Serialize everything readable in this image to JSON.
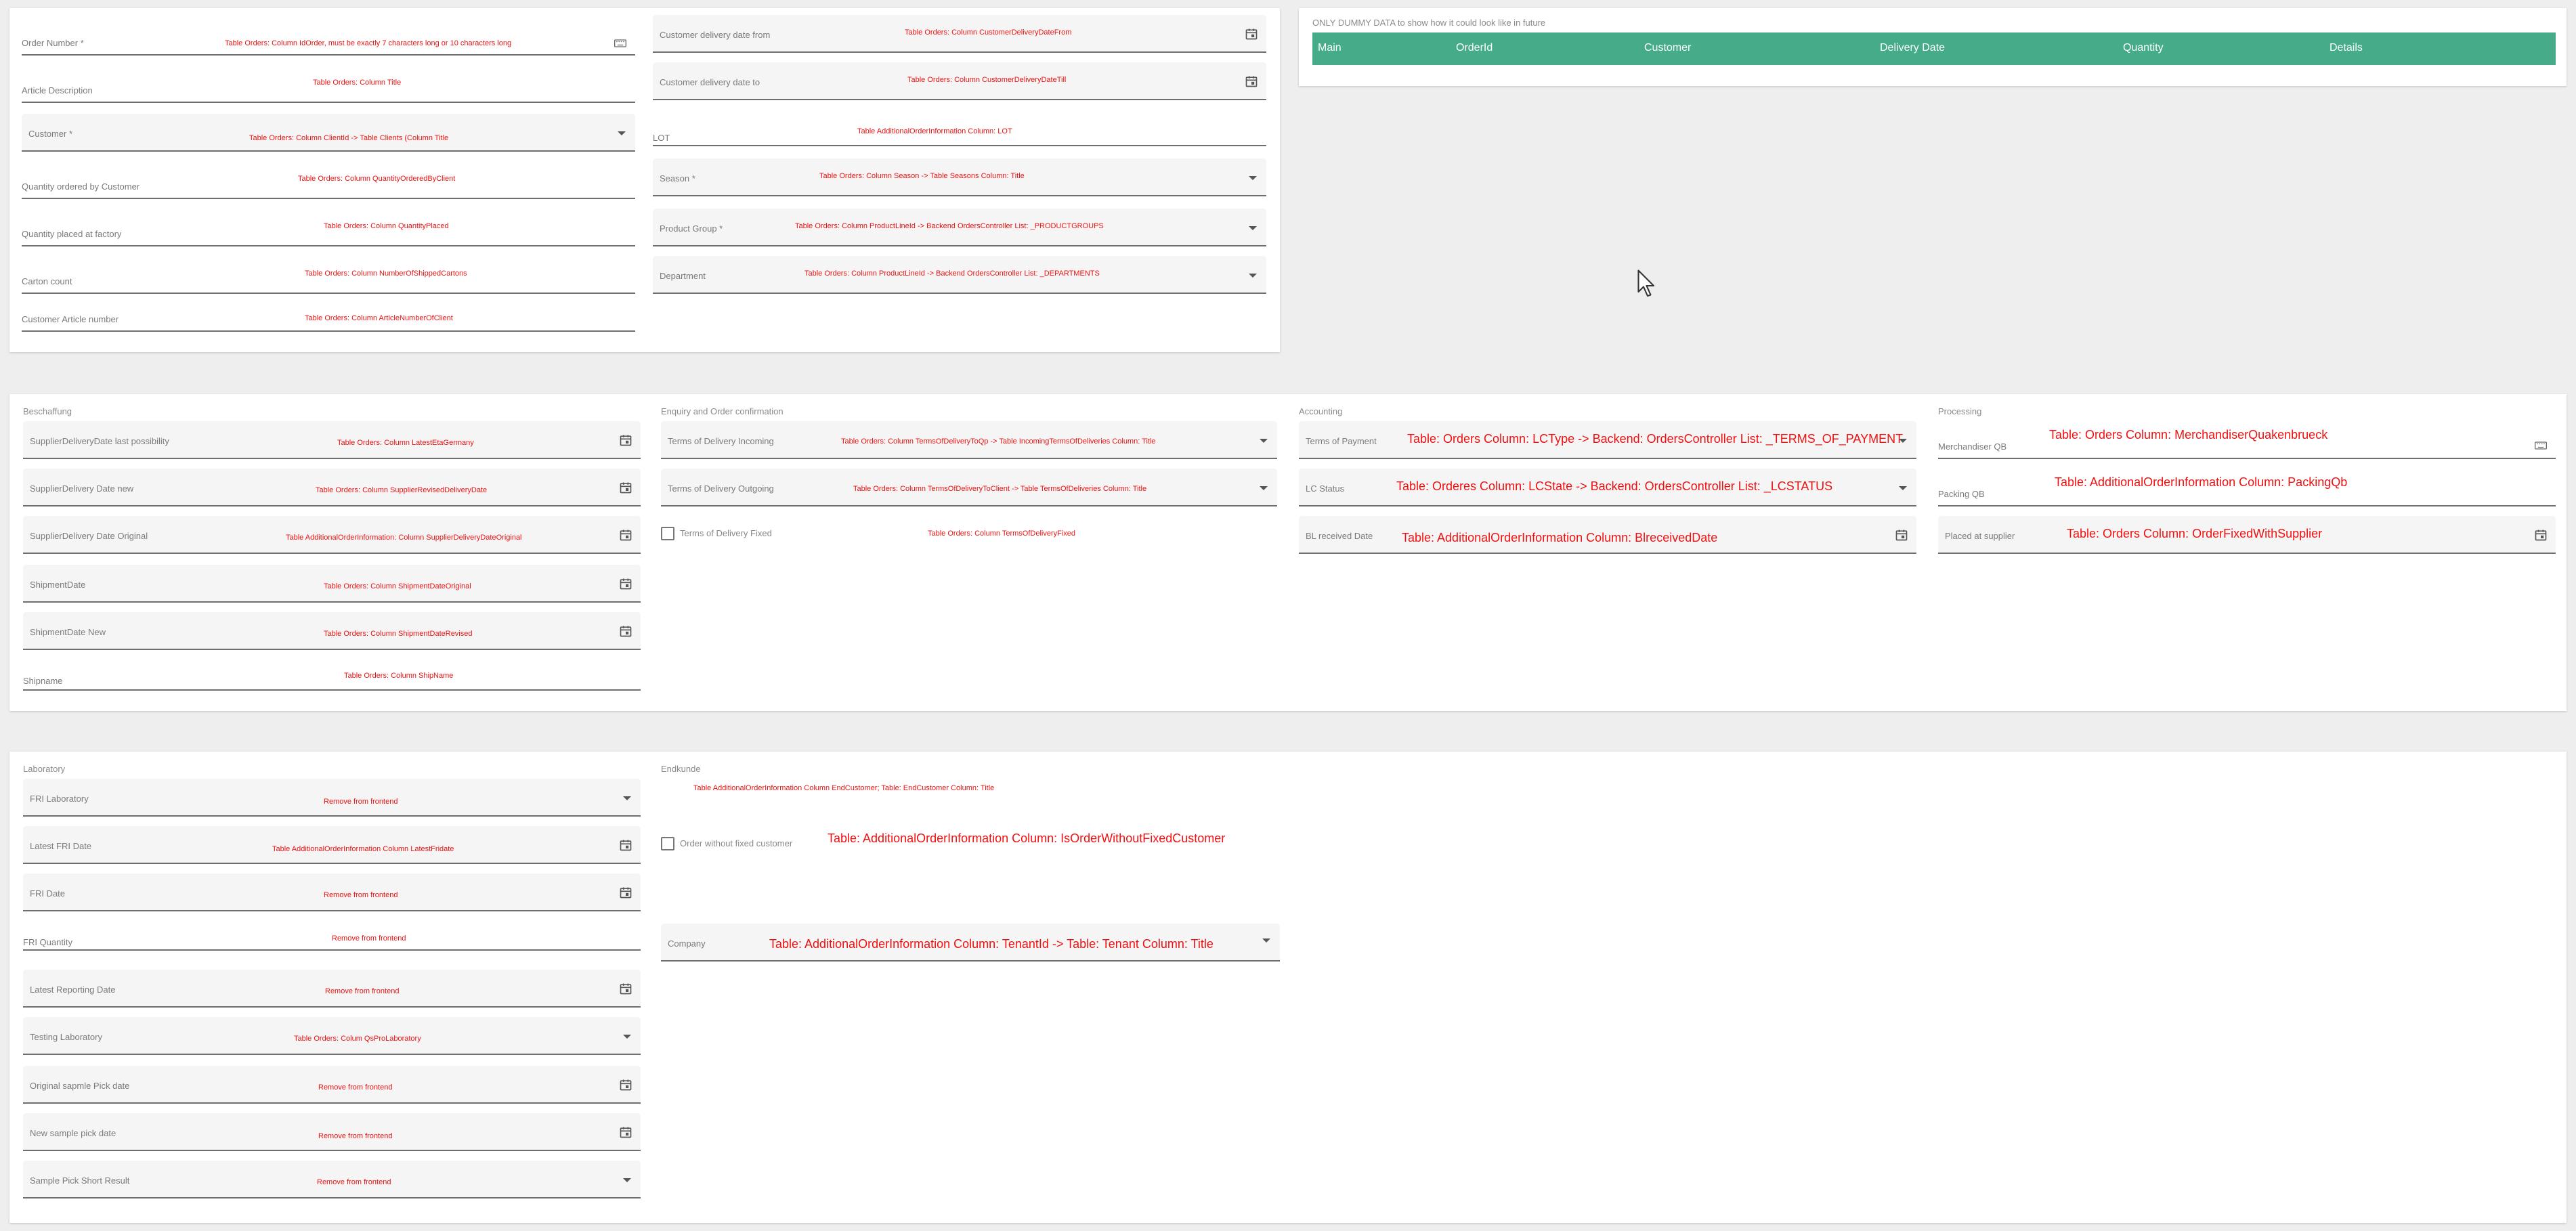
{
  "orderForm": {
    "left": [
      {
        "label": "Order Number *",
        "note": "Table Orders: Column IdOrder, must be exactly 7 characters long or 10 characters long",
        "icon": "calendar-icon"
      },
      {
        "label": "Article Description",
        "note": "Table Orders: Column Title"
      },
      {
        "label": "Customer *",
        "note": "Table Orders: Column ClientId -> Table Clients (Column Title",
        "icon": "dropdown-caret-icon"
      },
      {
        "label": "Quantity ordered by Customer",
        "note": "Table Orders: Column QuantityOrderedByClient"
      },
      {
        "label": "Quantity placed at factory",
        "note": "Table Orders: Column QuantityPlaced"
      },
      {
        "label": "Carton count",
        "note": "Table Orders: Column NumberOfShippedCartons"
      },
      {
        "label": "Customer Article number",
        "note": "Table Orders: Column ArticleNumberOfClient"
      }
    ],
    "right": [
      {
        "label": "Customer delivery date from",
        "note": "Table Orders: Column CustomerDeliveryDateFrom",
        "icon": "calendar-icon"
      },
      {
        "label": "Customer delivery date to",
        "note": "Table Orders: Column CustomerDeliveryDateTill",
        "icon": "calendar-icon"
      },
      {
        "label": "LOT",
        "note": "Table AdditionalOrderInformation Column: LOT"
      },
      {
        "label": "Season *",
        "note": "Table Orders: Column Season -> Table Seasons Column: Title",
        "icon": "dropdown-caret-icon"
      },
      {
        "label": "Product Group *",
        "note": "Table Orders: Column ProductLineId -> Backend OrdersController List: _PRODUCTGROUPS",
        "icon": "dropdown-caret-icon"
      },
      {
        "label": "Department",
        "note": "Table Orders: Column ProductLineId -> Backend OrdersController List: _DEPARTMENTS",
        "icon": "dropdown-caret-icon"
      }
    ]
  },
  "dummyTable": {
    "caption": "ONLY DUMMY DATA to show how it could look like in future",
    "columns": [
      "Main",
      "OrderId",
      "Customer",
      "Delivery Date",
      "Quantity",
      "Details"
    ]
  },
  "beschaffung": {
    "title": "Beschaffung",
    "fields": [
      {
        "label": "SupplierDeliveryDate last possibility",
        "note": "Table Orders: Column LatestEtaGermany",
        "icon": "calendar-icon"
      },
      {
        "label": "SupplierDelivery Date new",
        "note": "Table Orders: Column SupplierRevisedDeliveryDate",
        "icon": "calendar-icon"
      },
      {
        "label": "SupplierDelivery Date Original",
        "note": "Table AdditionalOrderInformation: Column SupplierDeliveryDateOriginal",
        "icon": "calendar-icon"
      },
      {
        "label": "ShipmentDate",
        "note": "Table Orders: Column ShipmentDateOriginal",
        "icon": "calendar-icon"
      },
      {
        "label": "ShipmentDate New",
        "note": "Table Orders: Column ShipmentDateRevised",
        "icon": "calendar-icon"
      },
      {
        "label": "Shipname",
        "note": "Table Orders: Column ShipName"
      }
    ]
  },
  "enquiry": {
    "title": "Enquiry and Order confirmation",
    "fields": [
      {
        "label": "Terms of Delivery Incoming",
        "note": "Table Orders: Column TermsOfDeliveryToQp -> Table IncomingTermsOfDeliveries Column: Title",
        "icon": "dropdown-caret-icon"
      },
      {
        "label": "Terms of Delivery Outgoing",
        "note": "Table Orders: Column TermsOfDeliveryToClient -> Table TermsOfDeliveries Column: Title",
        "icon": "dropdown-caret-icon"
      }
    ],
    "checkbox": {
      "label": "Terms of Delivery Fixed",
      "note": "Table Orders: Column TermsOfDeliveryFixed"
    }
  },
  "accounting": {
    "title": "Accounting",
    "fields": [
      {
        "label": "Terms of Payment",
        "note": "Table: Orders Column: LCType -> Backend: OrdersController List: _TERMS_OF_PAYMENT",
        "icon": "dropdown-caret-icon"
      },
      {
        "label": "LC Status",
        "note": "Table: Orderes Column: LCState -> Backend: OrdersController List: _LCSTATUS",
        "icon": "dropdown-caret-icon"
      },
      {
        "label": "BL received Date",
        "note": "Table: AdditionalOrderInformation Column: BlreceivedDate",
        "icon": "calendar-icon"
      }
    ]
  },
  "processing": {
    "title": "Processing",
    "fields": [
      {
        "label": "Merchandiser QB",
        "note": "Table: Orders Column: MerchandiserQuakenbrueck",
        "icon": "keyboard-icon"
      },
      {
        "label": "Packing QB",
        "note": "Table: AdditionalOrderInformation Column: PackingQb"
      },
      {
        "label": "Placed at supplier",
        "note": "Table: Orders Column: OrderFixedWithSupplier",
        "icon": "calendar-icon"
      }
    ]
  },
  "laboratory": {
    "title": "Laboratory",
    "fields": [
      {
        "label": "FRI Laboratory",
        "note": "Remove from frontend",
        "icon": "dropdown-caret-icon"
      },
      {
        "label": "Latest FRI Date",
        "note": "Table AdditionalOrderInformation Column LatestFridate",
        "icon": "calendar-icon"
      },
      {
        "label": "FRI Date",
        "note": "Remove from frontend",
        "icon": "calendar-icon"
      },
      {
        "label": "FRI Quantity",
        "note": "Remove from frontend"
      },
      {
        "label": "Latest Reporting Date",
        "note": "Remove from frontend",
        "icon": "calendar-icon"
      },
      {
        "label": "Testing Laboratory",
        "note": "Table Orders: Colum QsProLaboratory",
        "icon": "dropdown-caret-icon"
      },
      {
        "label": "Original sapmle Pick date",
        "note": "Remove from frontend",
        "icon": "calendar-icon"
      },
      {
        "label": "New sample pick date",
        "note": "Remove from frontend",
        "icon": "calendar-icon"
      },
      {
        "label": "Sample Pick Short Result",
        "note": "Remove from frontend",
        "icon": "dropdown-caret-icon"
      }
    ]
  },
  "endkunde": {
    "title": "Endkunde",
    "note": "Table AdditionalOrderInformation Column EndCustomer; Table: EndCustomer Column: Title",
    "checkbox": {
      "label": "Order without fixed customer",
      "note": "Table: AdditionalOrderInformation Column: IsOrderWithoutFixedCustomer"
    },
    "company": {
      "label": "Company",
      "note": "Table: AdditionalOrderInformation Column: TenantId -> Table: Tenant Column: Title",
      "icon": "dropdown-caret-icon"
    }
  }
}
